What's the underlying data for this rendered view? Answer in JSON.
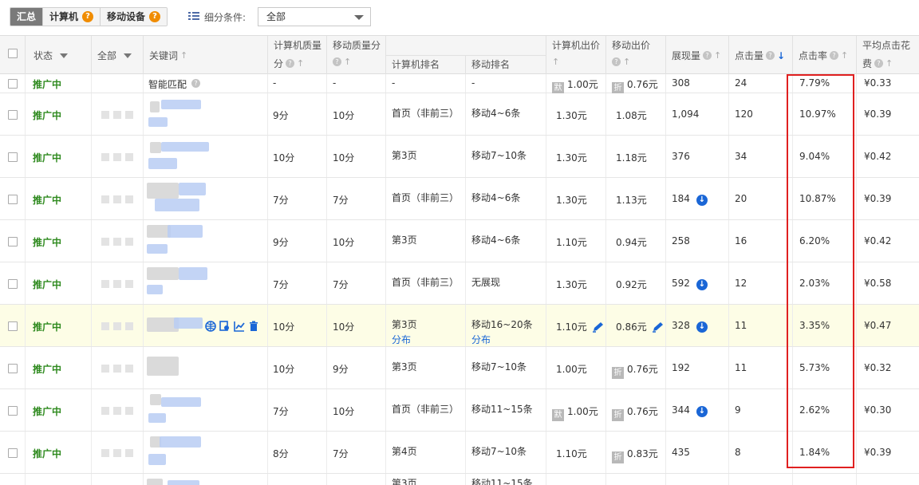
{
  "toolbar": {
    "tabs": [
      {
        "label": "汇总",
        "active": true,
        "has_help": false
      },
      {
        "label": "计算机",
        "active": false,
        "has_help": true
      },
      {
        "label": "移动设备",
        "active": false,
        "has_help": true
      }
    ],
    "help_mark": "?",
    "filter_label": "细分条件:",
    "filter_value": "全部"
  },
  "headers": {
    "status": "状态",
    "scope": "全部",
    "keyword": "关键词",
    "pc_quality_l1": "计算机质量",
    "pc_quality_l2": "分",
    "mobile_quality": "移动质量分",
    "rank_pc": "计算机排名",
    "rank_mobile": "移动排名",
    "pc_bid": "计算机出价",
    "mobile_bid": "移动出价",
    "impressions": "展现量",
    "clicks": "点击量",
    "ctr": "点击率",
    "avg_cost_l1": "平均点击花",
    "avg_cost_l2": "费"
  },
  "rows": [
    {
      "status": "推广中",
      "keyword": "智能匹配",
      "pc_q": "-",
      "m_q": "-",
      "rank_pc": "-",
      "rank_m": "-",
      "pc_tag": "默",
      "pc_bid": "1.00元",
      "m_tag": "折",
      "m_bid": "0.76元",
      "impr": "308",
      "clicks": "24",
      "ctr": "7.79%",
      "cpc": "¥0.33"
    },
    {
      "status": "推广中",
      "pc_q": "9分",
      "m_q": "10分",
      "rank_pc": "首页（非前三）",
      "rank_m": "移动4~6条",
      "pc_bid": "1.30元",
      "m_bid": "1.08元",
      "impr": "1,094",
      "clicks": "120",
      "ctr": "10.97%",
      "cpc": "¥0.39"
    },
    {
      "status": "推广中",
      "pc_q": "10分",
      "m_q": "10分",
      "rank_pc": "第3页",
      "rank_m": "移动7~10条",
      "pc_bid": "1.30元",
      "m_bid": "1.18元",
      "impr": "376",
      "clicks": "34",
      "ctr": "9.04%",
      "cpc": "¥0.42"
    },
    {
      "status": "推广中",
      "pc_q": "7分",
      "m_q": "7分",
      "rank_pc": "首页（非前三）",
      "rank_m": "移动4~6条",
      "pc_bid": "1.30元",
      "m_bid": "1.13元",
      "impr": "184",
      "clicks": "20",
      "ctr": "10.87%",
      "cpc": "¥0.39"
    },
    {
      "status": "推广中",
      "pc_q": "9分",
      "m_q": "10分",
      "rank_pc": "第3页",
      "rank_m": "移动4~6条",
      "pc_bid": "1.10元",
      "m_bid": "0.94元",
      "impr": "258",
      "clicks": "16",
      "ctr": "6.20%",
      "cpc": "¥0.42"
    },
    {
      "status": "推广中",
      "pc_q": "7分",
      "m_q": "7分",
      "rank_pc": "首页（非前三）",
      "rank_m": "无展现",
      "pc_bid": "1.30元",
      "m_bid": "0.92元",
      "impr": "592",
      "clicks": "12",
      "ctr": "2.03%",
      "cpc": "¥0.58"
    },
    {
      "status": "推广中",
      "pc_q": "10分",
      "m_q": "10分",
      "rank_pc": "第3页",
      "rank_m": "移动16~20条",
      "rank_link": "分布",
      "pc_bid": "1.10元",
      "m_bid": "0.86元",
      "impr": "328",
      "clicks": "11",
      "ctr": "3.35%",
      "cpc": "¥0.47"
    },
    {
      "status": "推广中",
      "pc_q": "10分",
      "m_q": "9分",
      "rank_pc": "第3页",
      "rank_m": "移动7~10条",
      "pc_bid": "1.00元",
      "m_tag": "折",
      "m_bid": "0.76元",
      "impr": "192",
      "clicks": "11",
      "ctr": "5.73%",
      "cpc": "¥0.32"
    },
    {
      "status": "推广中",
      "pc_q": "7分",
      "m_q": "10分",
      "rank_pc": "首页（非前三）",
      "rank_m": "移动11~15条",
      "pc_tag": "默",
      "pc_bid": "1.00元",
      "m_tag": "折",
      "m_bid": "0.76元",
      "impr": "344",
      "clicks": "9",
      "ctr": "2.62%",
      "cpc": "¥0.30"
    },
    {
      "status": "推广中",
      "pc_q": "8分",
      "m_q": "7分",
      "rank_pc": "第4页",
      "rank_m": "移动7~10条",
      "pc_bid": "1.10元",
      "m_tag": "折",
      "m_bid": "0.83元",
      "impr": "435",
      "clicks": "8",
      "ctr": "1.84%",
      "cpc": "¥0.39"
    },
    {
      "status": "",
      "pc_q": "",
      "m_q": "",
      "rank_pc": "第3页",
      "rank_m": "移动11~15条",
      "pc_bid": "",
      "m_bid": "",
      "impr": "",
      "clicks": "",
      "ctr": "",
      "cpc": ""
    }
  ],
  "colors": {
    "status_green": "#2f8a1f",
    "link_blue": "#1a66d6",
    "highlight_box": "#e02020",
    "active_tab": "#7a7a7a"
  }
}
